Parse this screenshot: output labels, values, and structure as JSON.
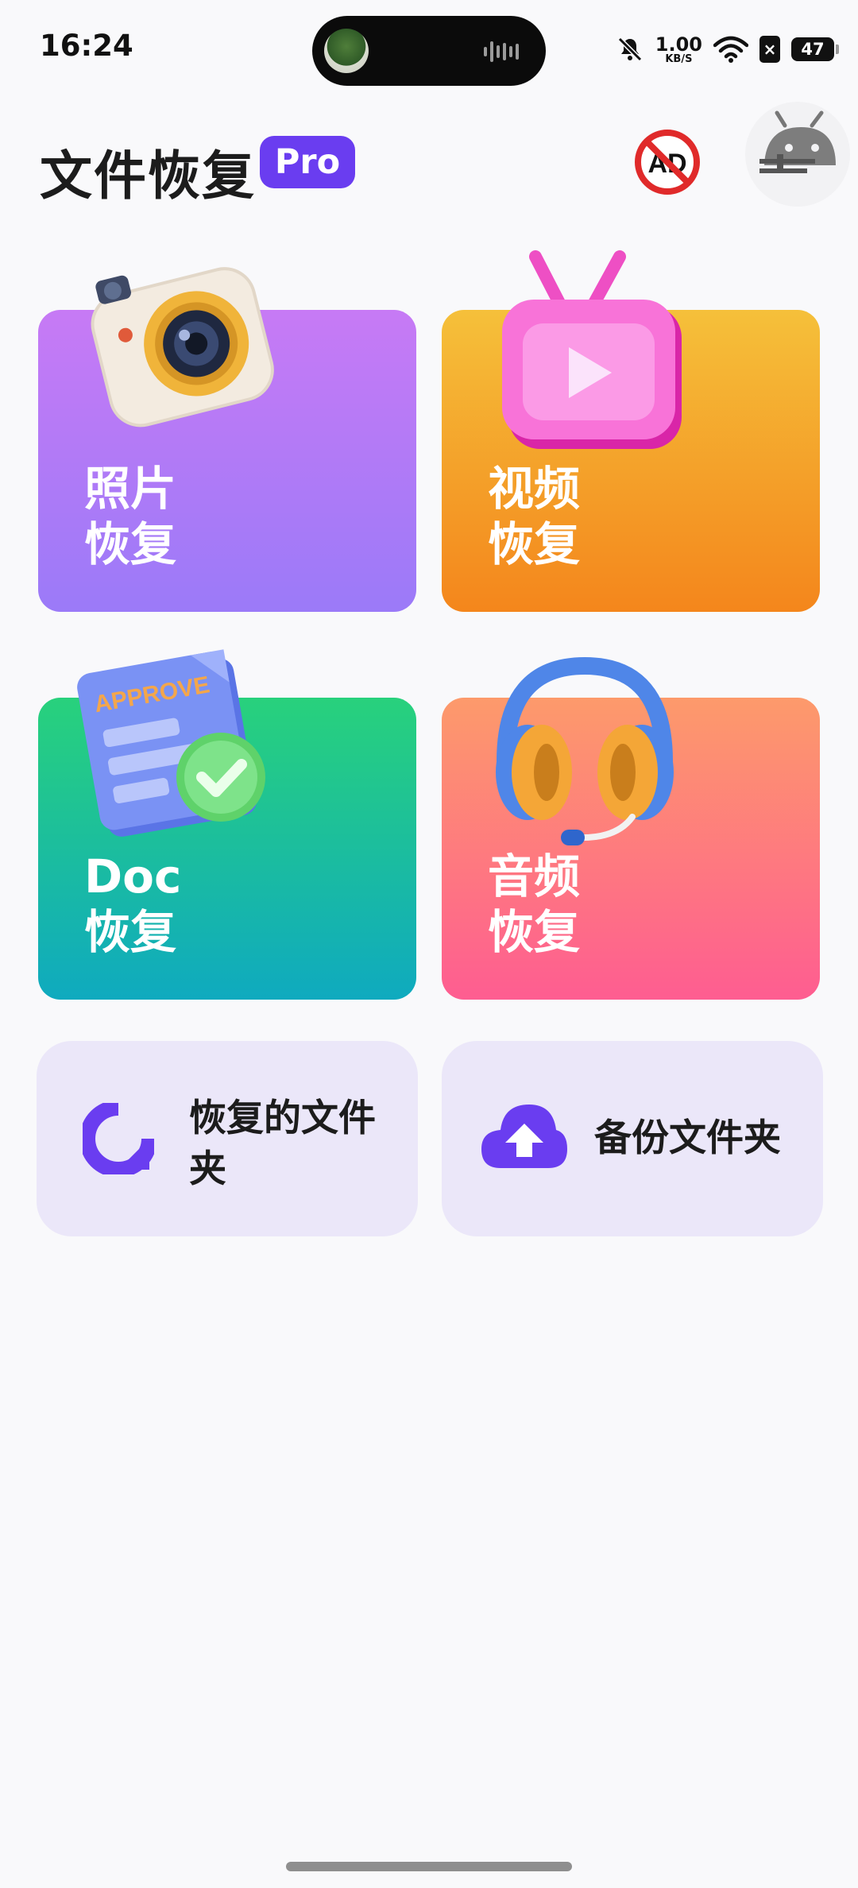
{
  "status_bar": {
    "time": "16:24",
    "net_speed_value": "1.00",
    "net_speed_unit": "KB/S",
    "sim_label": "×",
    "battery": "47",
    "icons": [
      "mute-icon",
      "wifi-icon",
      "sim-icon",
      "battery-icon"
    ]
  },
  "header": {
    "title": "文件恢复",
    "badge": "Pro",
    "ad_icon_text": "AD"
  },
  "cards": {
    "photo": {
      "line1": "照片",
      "line2": "恢复",
      "icon": "camera-icon"
    },
    "video": {
      "line1": "视频",
      "line2": "恢复",
      "icon": "tv-play-icon"
    },
    "doc": {
      "line1": "Doc",
      "line2": "恢复",
      "icon": "document-approved-icon",
      "art_text": "APPROVE"
    },
    "audio": {
      "line1": "音频",
      "line2": "恢复",
      "icon": "headphones-icon"
    }
  },
  "actions": {
    "recovered_folder": {
      "line1": "恢复的文件",
      "line2": "夹",
      "icon": "restore-icon"
    },
    "backup_folder": {
      "label": "备份文件夹",
      "icon": "cloud-upload-icon"
    }
  },
  "colors": {
    "accent": "#6a3df0",
    "photo_gradient": [
      "#c77af5",
      "#9b7af8"
    ],
    "video_gradient": [
      "#f5c03a",
      "#f4861c"
    ],
    "doc_gradient": [
      "#28d17c",
      "#0faabf"
    ],
    "audio_gradient": [
      "#fd9a6b",
      "#fe5d91"
    ],
    "pill_background": "#ebe7f9"
  }
}
